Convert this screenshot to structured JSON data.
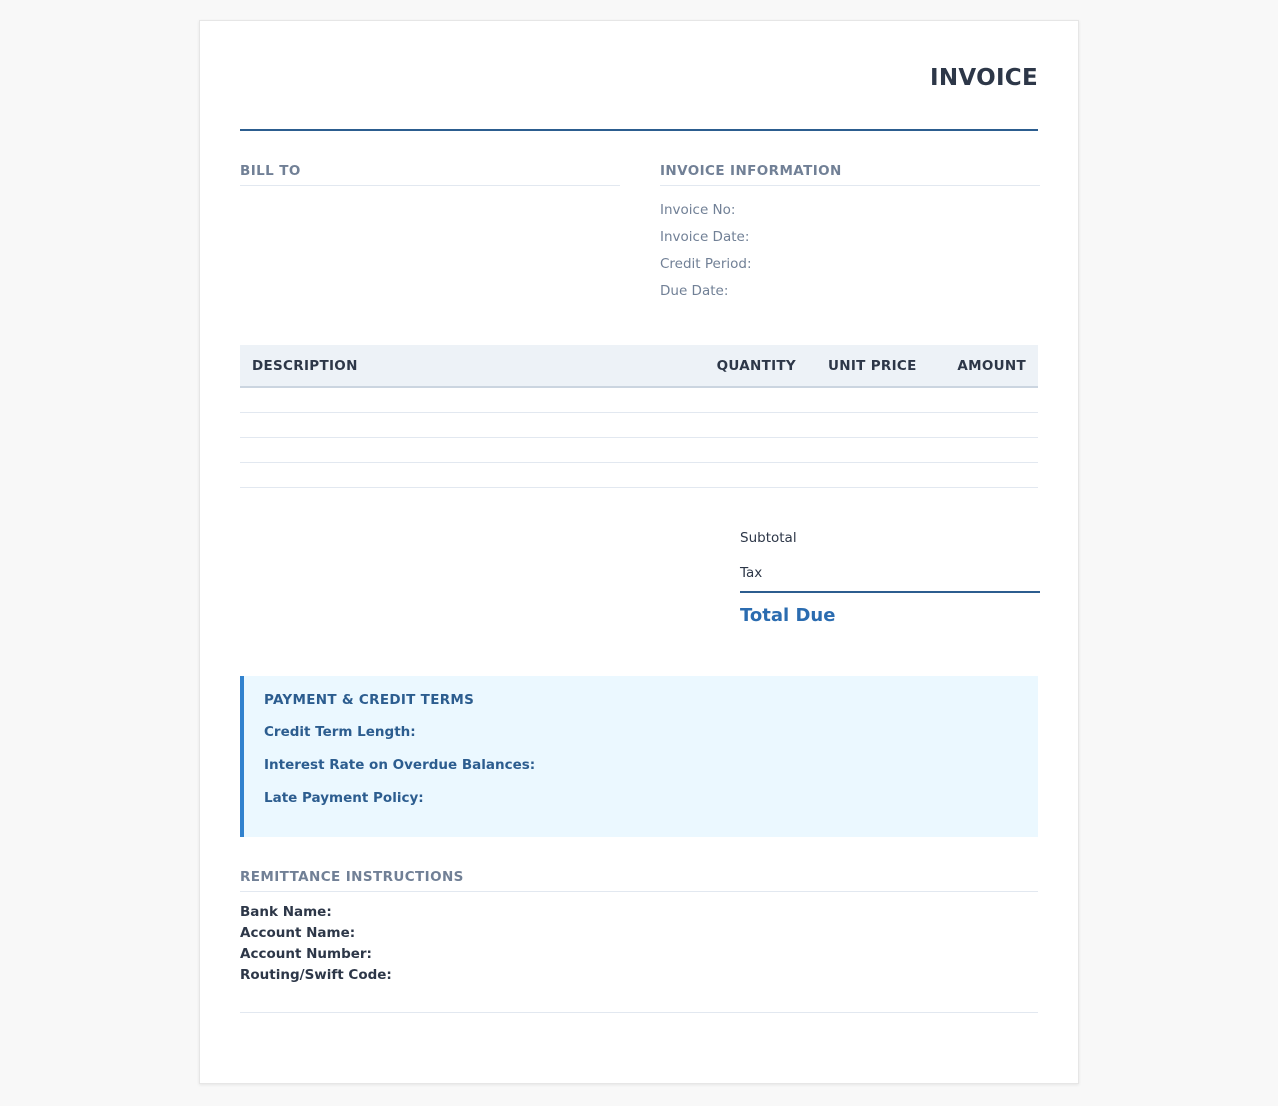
{
  "header": {
    "title": "INVOICE"
  },
  "bill_to": {
    "label": "BILL TO"
  },
  "invoice_info": {
    "label": "INVOICE INFORMATION",
    "rows": [
      "Invoice No:",
      "Invoice Date:",
      "Credit Period:",
      "Due Date:"
    ]
  },
  "items_table": {
    "columns": [
      "DESCRIPTION",
      "QUANTITY",
      "UNIT PRICE",
      "AMOUNT"
    ],
    "rows": [
      [],
      [],
      [],
      []
    ]
  },
  "totals": {
    "subtotal_label": "Subtotal",
    "tax_label": "Tax",
    "total_label": "Total Due"
  },
  "terms": {
    "title": "PAYMENT & CREDIT TERMS",
    "items": [
      "Credit Term Length:",
      "Interest Rate on Overdue Balances:",
      "Late Payment Policy:"
    ]
  },
  "remittance": {
    "label": "REMITTANCE INSTRUCTIONS",
    "rows": [
      "Bank Name:",
      "Account Name:",
      "Account Number:",
      "Routing/Swift Code:"
    ]
  },
  "colors": {
    "accent": "#2c5d8f",
    "total_text": "#2b6cb0",
    "terms_bg": "#ebf8ff",
    "terms_border": "#3182ce"
  }
}
